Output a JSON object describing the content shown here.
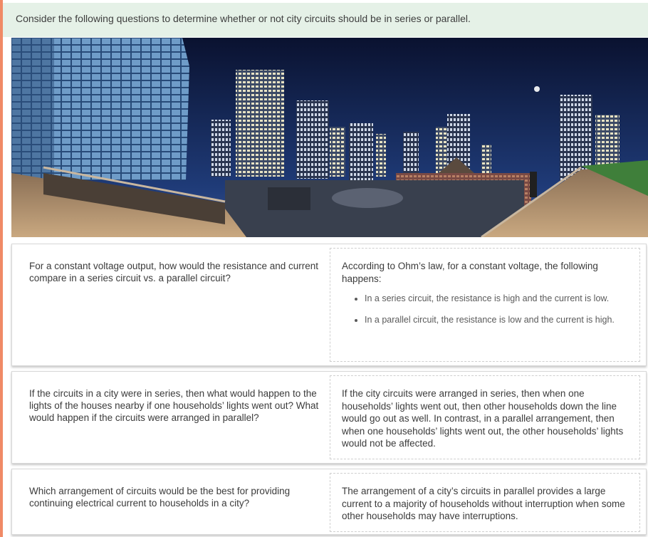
{
  "banner": {
    "text": "Consider the following questions to determine whether or not city circuits should be in series or parallel."
  },
  "colors": {
    "accent_stripe": "#f08a66",
    "banner_bg": "#e5f1e7",
    "sky_top": "#0a1230",
    "sky_bottom": "#1f3b78"
  },
  "hero": {
    "icon": "night-city-panorama-image"
  },
  "cards": [
    {
      "question": "For a constant voltage output, how would the resistance and current compare in a series circuit vs. a parallel circuit?",
      "answer_intro": "According to Ohm’s law, for a constant voltage, the following happens:",
      "answer_bullets": [
        "In a series circuit, the resistance is high and the current is low.",
        "In a parallel circuit, the resistance is low and the current is high."
      ]
    },
    {
      "question": "If the circuits in a city were in series, then what would happen to the lights of the houses nearby if one households’ lights went out? What would happen if the circuits were arranged in parallel?",
      "answer": "If the city circuits were arranged in series, then when one households’ lights went out, then other households down the line would go out as well. In contrast, in a parallel arrangement, then when one households’ lights went out, the other households’ lights would not be affected."
    },
    {
      "question": "Which arrangement of circuits would be the best for providing continuing electrical current to households in a city?",
      "answer": "The arrangement of a city’s circuits in parallel provides a large current to a majority of households without interruption when some other households may have interruptions."
    }
  ]
}
